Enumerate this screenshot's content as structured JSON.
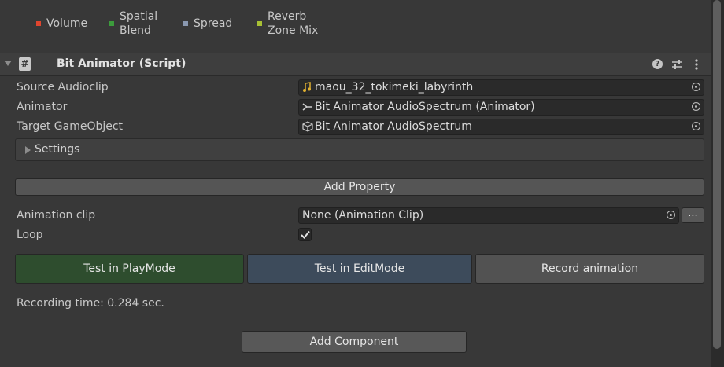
{
  "legend": [
    {
      "label_line1": "Volume",
      "label_line2": "",
      "color": "#e0452e"
    },
    {
      "label_line1": "Spatial",
      "label_line2": "Blend",
      "color": "#3c9c3c"
    },
    {
      "label_line1": "Spread",
      "label_line2": "",
      "color": "#8a98b0"
    },
    {
      "label_line1": "Reverb",
      "label_line2": "Zone Mix",
      "color": "#a8c034"
    }
  ],
  "component": {
    "title": "Bit Animator (Script)",
    "icons": [
      "help-icon",
      "presets-icon",
      "menu-dots-icon"
    ]
  },
  "fields": {
    "source_audioclip": {
      "label": "Source Audioclip",
      "value": "maou_32_tokimeki_labyrinth",
      "icon": "audio-clip-icon"
    },
    "animator": {
      "label": "Animator",
      "value": "Bit Animator AudioSpectrum (Animator)",
      "icon": "animator-icon"
    },
    "target_gameobject": {
      "label": "Target GameObject",
      "value": "Bit Animator AudioSpectrum",
      "icon": "gameobject-icon"
    }
  },
  "settings": {
    "label": "Settings"
  },
  "add_property": {
    "label": "Add Property"
  },
  "animation_clip": {
    "label": "Animation clip",
    "value": "None (Animation Clip)",
    "more": "..."
  },
  "loop": {
    "label": "Loop",
    "checked": true
  },
  "buttons": {
    "play": {
      "label": "Test in PlayMode",
      "color": "#2e4d2e"
    },
    "edit": {
      "label": "Test in EditMode",
      "color": "#3d4b5b"
    },
    "record": {
      "label": "Record animation",
      "color": "#525252"
    }
  },
  "recording_time": "Recording time: 0.284 sec.",
  "add_component": {
    "label": "Add Component"
  }
}
